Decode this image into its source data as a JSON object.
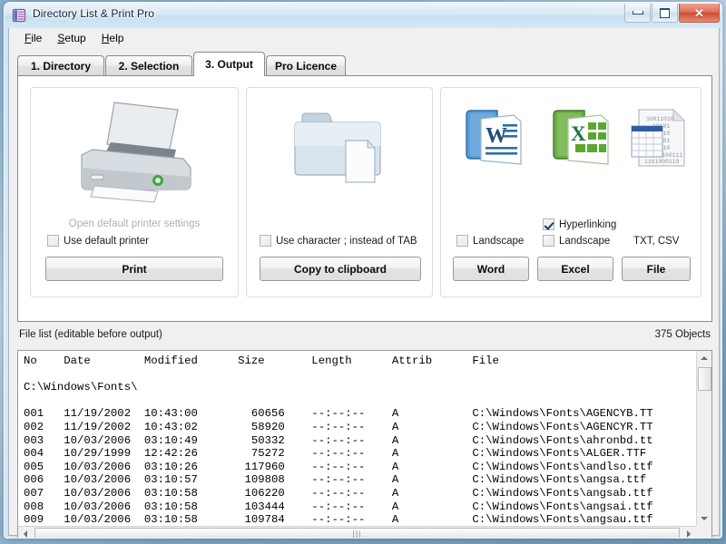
{
  "window": {
    "title": "Directory List & Print Pro",
    "app_icon": "directory-list-icon",
    "minimize_label": "Minimize",
    "maximize_label": "Maximize",
    "close_label": "Close"
  },
  "menu": {
    "items": [
      {
        "label": "File",
        "accel": "F"
      },
      {
        "label": "Setup",
        "accel": "S"
      },
      {
        "label": "Help",
        "accel": "H"
      }
    ]
  },
  "tabs": [
    {
      "label": "1. Directory",
      "active": false
    },
    {
      "label": "2. Selection",
      "active": false
    },
    {
      "label": "3. Output",
      "active": true
    },
    {
      "label": "Pro Licence",
      "active": false
    }
  ],
  "output_panel": {
    "print_group": {
      "icon": "printer-icon",
      "hint": "Open default printer settings",
      "checkbox": {
        "label": "Use default printer",
        "checked": false
      },
      "button": "Print"
    },
    "clipboard_group": {
      "icon": "folder-document-icon",
      "checkbox": {
        "label": "Use character  ;  instead of TAB",
        "checked": false
      },
      "button": "Copy to clipboard"
    },
    "export_group": {
      "icons": [
        "word-icon",
        "excel-icon",
        "textfile-icon"
      ],
      "word_landscape": {
        "label": "Landscape",
        "checked": false
      },
      "excel_hyperlinking": {
        "label": "Hyperlinking",
        "checked": true
      },
      "excel_landscape": {
        "label": "Landscape",
        "checked": false
      },
      "file_formats": "TXT, CSV",
      "buttons": [
        "Word",
        "Excel",
        "File"
      ]
    }
  },
  "file_list": {
    "title": "File list (editable before output)",
    "object_count": "375 Objects",
    "header": "No    Date        Modified      Size       Length      Attrib      File",
    "path_line": "C:\\Windows\\Fonts\\",
    "rows": [
      "001   11/19/2002  10:43:00        60656    --:--:--    A           C:\\Windows\\Fonts\\AGENCYB.TT",
      "002   11/19/2002  10:43:02        58920    --:--:--    A           C:\\Windows\\Fonts\\AGENCYR.TT",
      "003   10/03/2006  03:10:49        50332    --:--:--    A           C:\\Windows\\Fonts\\ahronbd.tt",
      "004   10/29/1999  12:42:26        75272    --:--:--    A           C:\\Windows\\Fonts\\ALGER.TTF",
      "005   10/03/2006  03:10:26       117960    --:--:--    A           C:\\Windows\\Fonts\\andlso.ttf",
      "006   10/03/2006  03:10:57       109808    --:--:--    A           C:\\Windows\\Fonts\\angsa.ttf",
      "007   10/03/2006  03:10:58       106220    --:--:--    A           C:\\Windows\\Fonts\\angsab.ttf",
      "008   10/03/2006  03:10:58       103444    --:--:--    A           C:\\Windows\\Fonts\\angsai.ttf",
      "009   10/03/2006  03:10:58       109784    --:--:--    A           C:\\Windows\\Fonts\\angsau.ttf"
    ],
    "hscroll_grip": "|||"
  },
  "colors": {
    "accent_blue": "#2b5797",
    "word_blue": "#2b579a",
    "excel_green": "#217346",
    "check_navy": "#1f3a63",
    "close_red": "#cf4b31"
  }
}
